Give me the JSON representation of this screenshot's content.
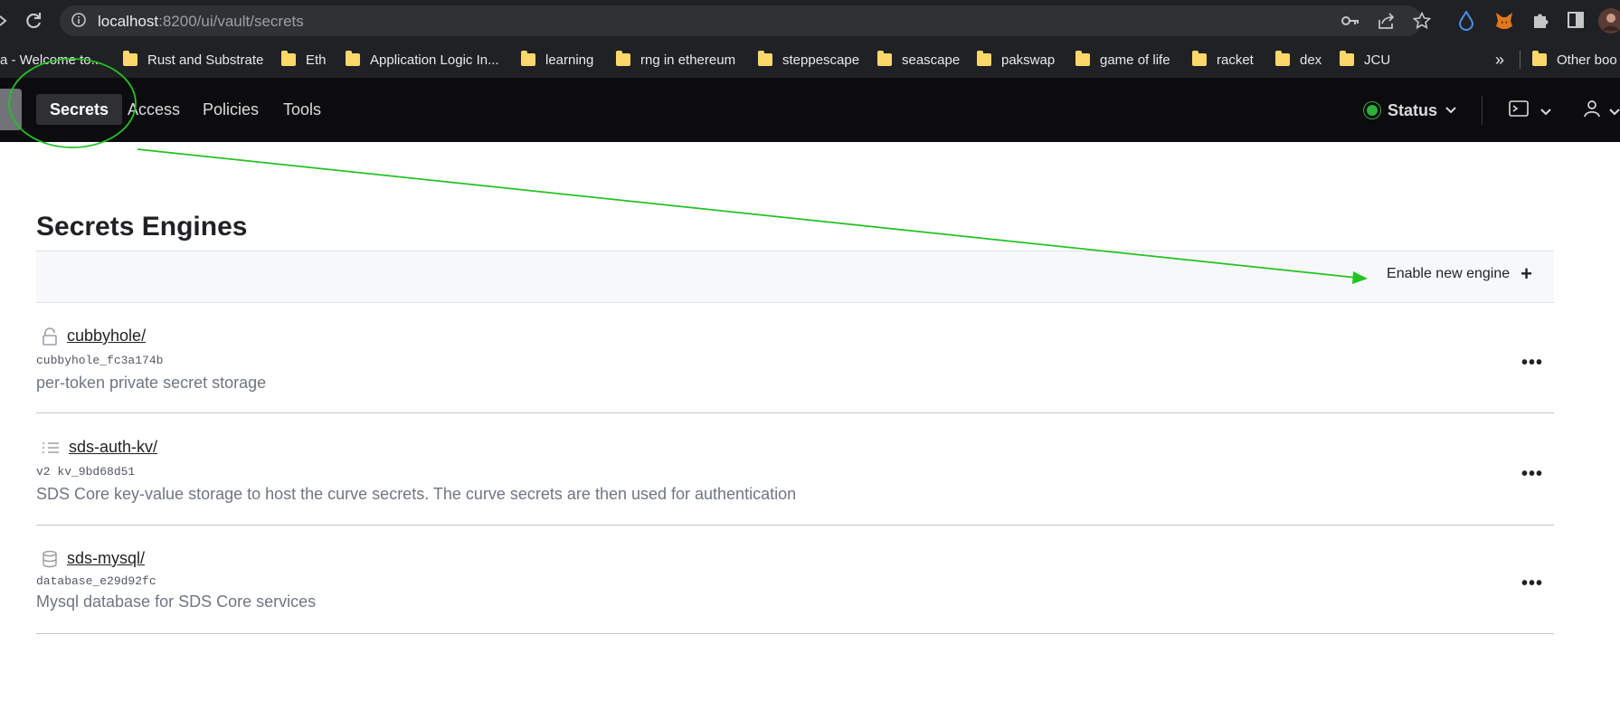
{
  "browser": {
    "url_host": "localhost",
    "url_path": ":8200/ui/vault/secrets",
    "bookmarks": [
      {
        "label": "a - Welcome to...",
        "folder": false
      },
      {
        "label": "Rust and Substrate",
        "folder": true
      },
      {
        "label": "Eth",
        "folder": true
      },
      {
        "label": "Application Logic In...",
        "folder": true
      },
      {
        "label": "learning",
        "folder": true
      },
      {
        "label": "rng in ethereum",
        "folder": true
      },
      {
        "label": "steppescape",
        "folder": true
      },
      {
        "label": "seascape",
        "folder": true
      },
      {
        "label": "pakswap",
        "folder": true
      },
      {
        "label": "game of life",
        "folder": true
      },
      {
        "label": "racket",
        "folder": true
      },
      {
        "label": "dex",
        "folder": true
      },
      {
        "label": "JCU",
        "folder": true
      }
    ],
    "overflow_label": "»",
    "other_bookmarks": "Other boo"
  },
  "header": {
    "nav": [
      {
        "label": "Secrets",
        "active": true
      },
      {
        "label": "Access",
        "active": false
      },
      {
        "label": "Policies",
        "active": false
      },
      {
        "label": "Tools",
        "active": false
      }
    ],
    "status_label": "Status",
    "status_color": "#2eb039"
  },
  "main": {
    "title": "Secrets Engines",
    "enable_label": "Enable new engine",
    "engines": [
      {
        "path": "cubbyhole/",
        "icon": "lock-icon",
        "accessor": "cubbyhole_fc3a174b",
        "description": "per-token private secret storage"
      },
      {
        "path": "sds-auth-kv/",
        "icon": "list-icon",
        "accessor": "v2 kv_9bd68d51",
        "description": "SDS Core key-value storage to host the curve secrets. The curve secrets are then used for authentication"
      },
      {
        "path": "sds-mysql/",
        "icon": "database-icon",
        "accessor": "database_e29d92fc",
        "description": "Mysql database for SDS Core services"
      }
    ],
    "more_label": "•••"
  },
  "colors": {
    "annotation": "#22c322",
    "header_bg": "#0c0c0e",
    "chrome_bg": "#202124"
  }
}
